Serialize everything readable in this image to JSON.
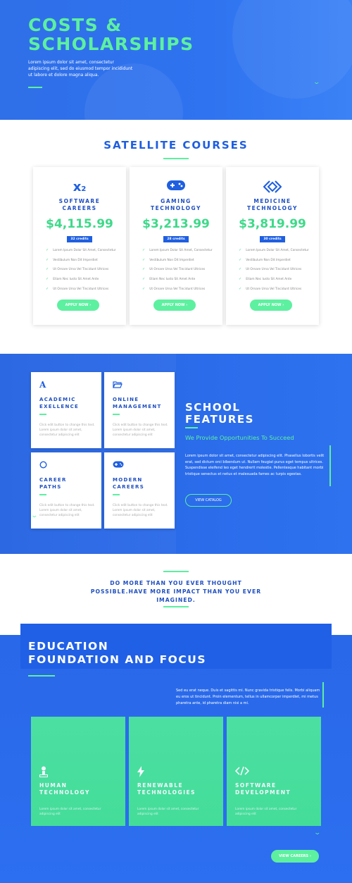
{
  "hero": {
    "title_line1": "COSTS &",
    "title_line2": "SCHOLARSHIPS",
    "lead": "Lorem ipsum dolor sit amet, consectetur adipiscing elit, sed do eiusmod tempor incididunt ut labore et dolore magna aliqua."
  },
  "satellite": {
    "title": "SATELLITE COURSES",
    "courses": [
      {
        "icon": "subscript-x2-icon",
        "title_line1": "SOFTWARE",
        "title_line2": "CAREERS",
        "price": "$4,115.99",
        "credits": "32 credits",
        "features": [
          "Lorem Ipsum Dolor Sit Amet, Consectetur",
          "Vestibulum Non Dit Imperdiet",
          "Ut Ornare Urna Vel Tincidunt Ultrices",
          "Etiam Nec Iusto Sit Amet Ante",
          "Ut Ornare Urna Vel Tincidunt Ultrices"
        ],
        "button": "APPLY NOW ›"
      },
      {
        "icon": "gamepad-icon",
        "title_line1": "GAMING",
        "title_line2": "TECHNOLOGY",
        "price": "$3,213.99",
        "credits": "28 credits",
        "features": [
          "Lorem Ipsum Dolor Sit Amet, Consectetur",
          "Vestibulum Non Dit Imperdiet",
          "Ut Ornare Urna Vel Tincidunt Ultrices",
          "Etiam Nec Iusto Sit Amet Ante",
          "Ut Ornare Urna Vel Tincidunt Ultrices"
        ],
        "button": "APPLY NOW ›"
      },
      {
        "icon": "code-diamond-icon",
        "title_line1": "MEDICINE",
        "title_line2": "TECHNOLOGY",
        "price": "$3,819.99",
        "credits": "30 credits",
        "features": [
          "Lorem Ipsum Dolor Sit Amet, Consectetur",
          "Vestibulum Non Dit Imperdiet",
          "Ut Ornare Urna Vel Tincidunt Ultrices",
          "Etiam Nec Iusto Sit Amet Ante",
          "Ut Ornare Urna Vel Tincidunt Ultrices"
        ],
        "button": "APPLY NOW ›"
      }
    ]
  },
  "features": {
    "boxes": [
      {
        "icon": "letter-a-icon",
        "title_line1": "ACADEMIC",
        "title_line2": "EXELLENCE",
        "text": "Click edit button to change this text. Lorem ipsum dolor sit amet, consectetur adipiscing elit"
      },
      {
        "icon": "folder-open-icon",
        "title_line1": "ONLINE",
        "title_line2": "MANAGEMENT",
        "text": "Click edit button to change this text. Lorem ipsum dolor sit amet, consectetur adipiscing elit"
      },
      {
        "icon": "circle-icon",
        "title_line1": "CAREER",
        "title_line2": "PATHS",
        "text": "Click edit button to change this text. Lorem ipsum dolor sit amet, consectetur adipiscing elit"
      },
      {
        "icon": "gamepad-icon",
        "title_line1": "MODERN",
        "title_line2": "CAREERS",
        "text": "Click edit button to change this text. Lorem ipsum dolor sit amet, consectetur adipiscing elit"
      }
    ],
    "title_line1": "SCHOOL",
    "title_line2": "FEATURES",
    "subtitle": "We Provide Opportunities To Succeed",
    "text": "Lorem ipsum dolor sit amet, consectetur adipiscing elit. Phasellus lobortis velit erat, sed dictum orci bibendum ut. Nullam feugiat purus eget tempus ultrices. Suspendisse eleifend leo eget hendrerit molestie. Pellentesque habitant morbi tristique senectus et netus et malesuada fames ac turpis egestas.",
    "button": "VIEW CATALOG"
  },
  "quote": {
    "text": "DO MORE THAN YOU EVER THOUGHT POSSIBLE.HAVE MORE IMPACT THAN YOU EVER IMAGINED."
  },
  "education": {
    "title_line1": "EDUCATION",
    "title_line2": "FOUNDATION AND FOCUS",
    "text": "Sed eu erat neque. Duis et sagittis mi. Nunc gravida tristique felis. Morbi aliquam eu eros ut tincidunt. Proin elementum, tellus in ullamcorper imperdiet, mi metus pharetra ante, id pharetra diam nisi a mi.",
    "tiles": [
      {
        "icon": "person-podium-icon",
        "title_line1": "HUMAN",
        "title_line2": "TECHNOLOGY",
        "text": "Lorem ipsum dolor sit amet, consectetur adipiscing elit"
      },
      {
        "icon": "lightning-bolt-icon",
        "title_line1": "RENEWABLE",
        "title_line2": "TECHNOLOGIES",
        "text": "Lorem ipsum dolor sit amet, consectetur adipiscing elit"
      },
      {
        "icon": "code-brackets-icon",
        "title_line1": "SOFTWARE",
        "title_line2": "DEVELOPMENT",
        "text": "Lorem ipsum dolor sit amet, consectetur adipiscing elit"
      }
    ],
    "button": "VIEW CAREERS ›"
  },
  "colors": {
    "brand_blue": "#1f5fe0",
    "accent_green": "#5df0a0",
    "price_green": "#3fd98a"
  }
}
